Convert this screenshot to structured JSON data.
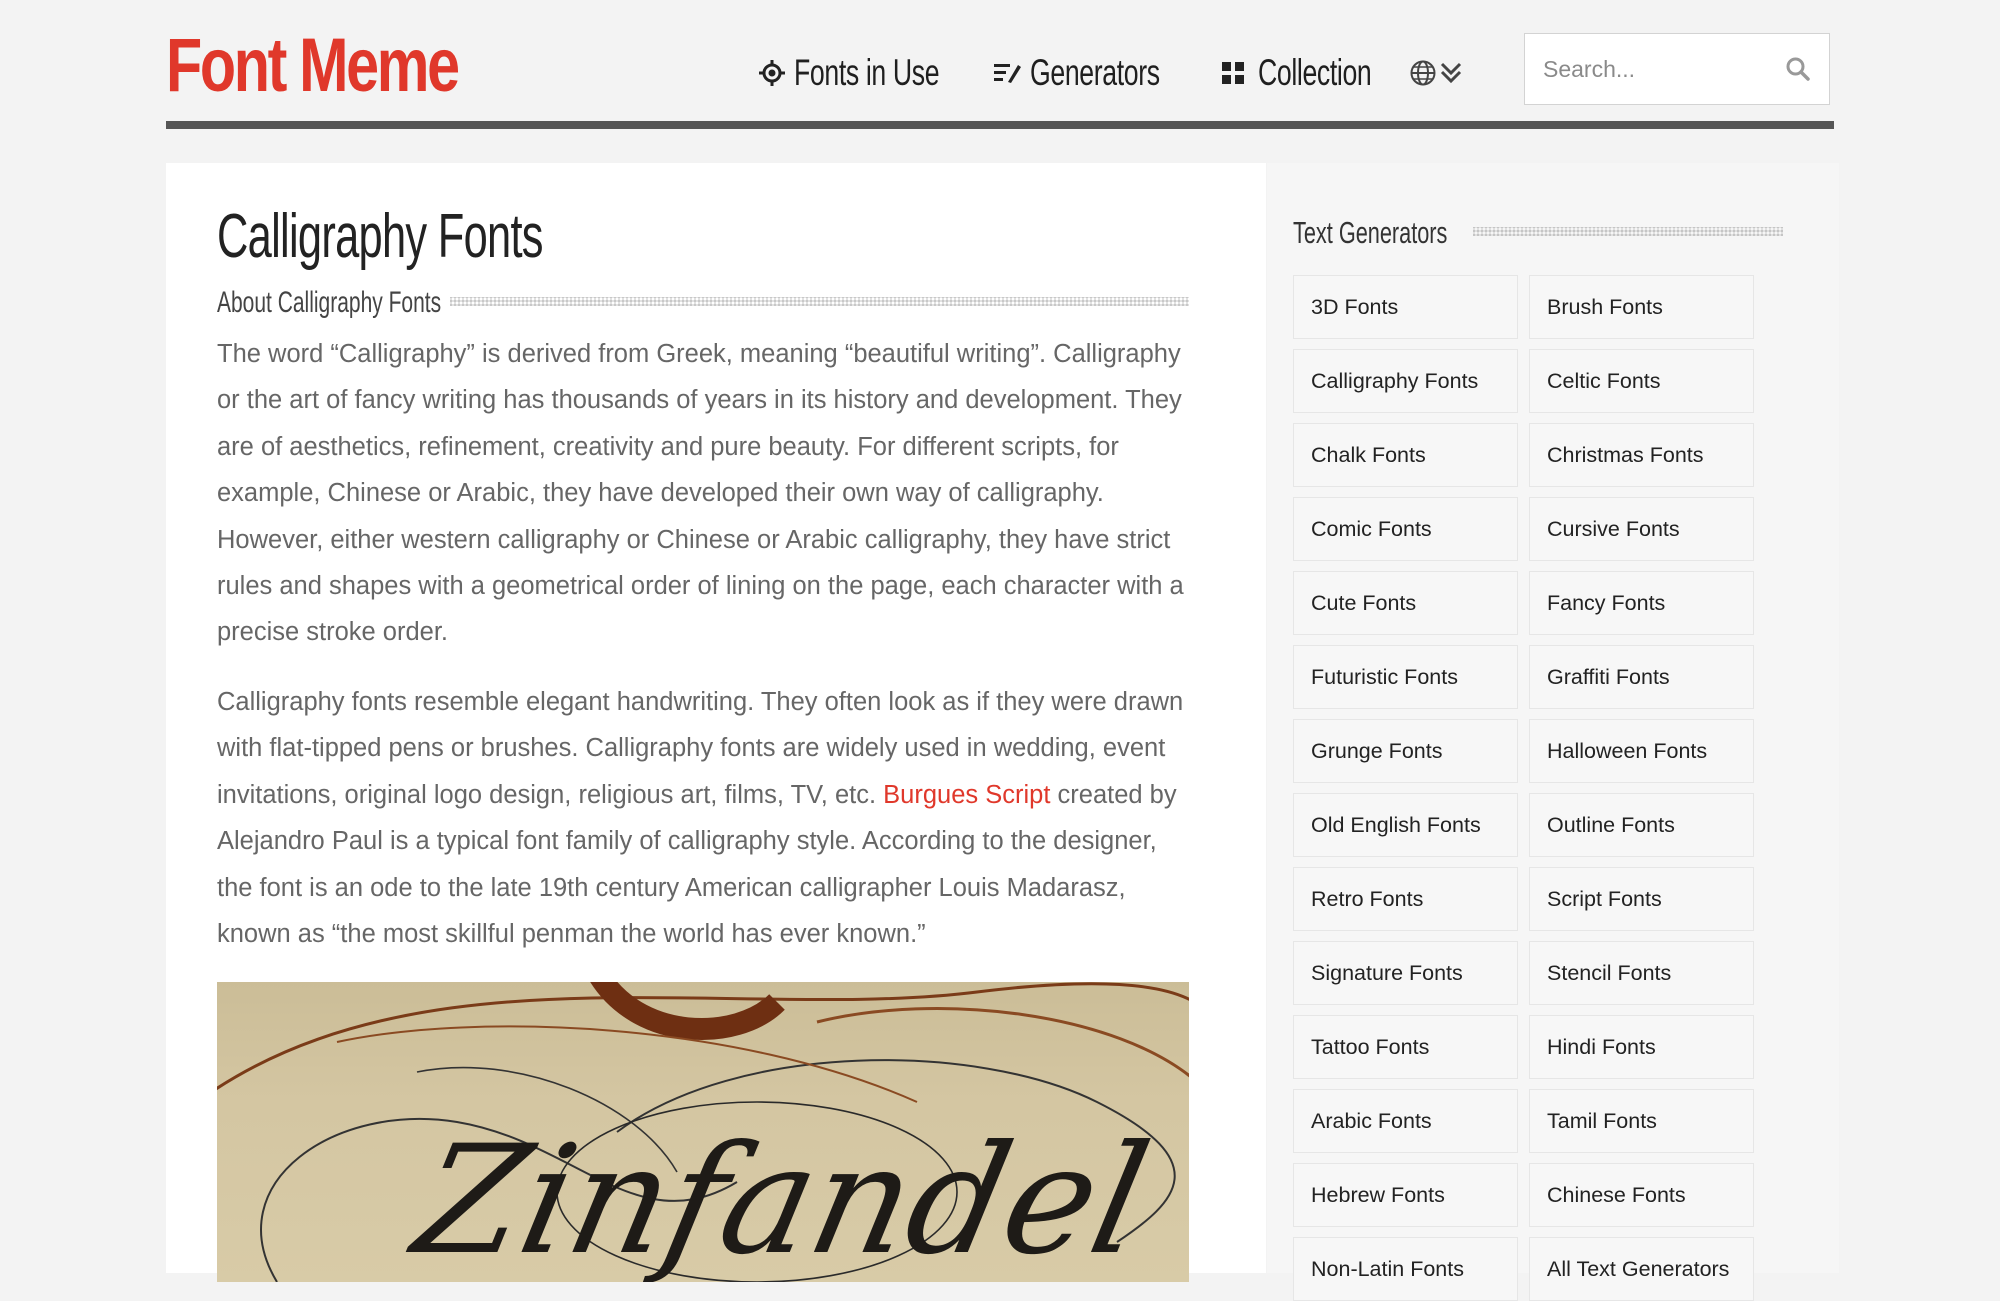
{
  "header": {
    "logo": "Font Meme",
    "nav": [
      {
        "label": "Fonts in Use",
        "icon": "crosshair-icon"
      },
      {
        "label": "Generators",
        "icon": "generators-list-icon"
      },
      {
        "label": "Collection",
        "icon": "grid-icon"
      }
    ],
    "language_icon": "globe-icon",
    "dropdown_icon": "double-chevron-down-icon",
    "search": {
      "placeholder": "Search...",
      "value": ""
    }
  },
  "main": {
    "title": "Calligraphy Fonts",
    "section_title": "About Calligraphy Fonts",
    "paragraph1": "The word “Calligraphy” is derived from Greek, meaning “beautiful writing”. Calligraphy or the art of fancy writing has thousands of years in its history and development. They are of aesthetics, refinement, creativity and pure beauty. For different scripts, for example, Chinese or Arabic, they have developed their own way of calligraphy. However, either western calligraphy or Chinese or Arabic calligraphy, they have strict rules and shapes with a geometrical order of lining on the page, each character with a precise stroke order.",
    "paragraph2_before": "Calligraphy fonts resemble elegant handwriting. They often look as if they were drawn with flat-tipped pens or brushes. Calligraphy fonts are widely used in wedding, event invitations, original logo design, religious art, films, TV, etc.",
    "paragraph2_link": "Burgues Script",
    "paragraph2_after": "created by Alejandro Paul is a typical font family of calligraphy style. According to the designer, the font is an ode to the late 19th century American calligrapher Louis Madarasz, known as “the most skillful penman the world has ever known.”",
    "hero_text": "Zinfandel"
  },
  "sidebar": {
    "title": "Text Generators",
    "items": [
      "3D Fonts",
      "Brush Fonts",
      "Calligraphy Fonts",
      "Celtic Fonts",
      "Chalk Fonts",
      "Christmas Fonts",
      "Comic Fonts",
      "Cursive Fonts",
      "Cute Fonts",
      "Fancy Fonts",
      "Futuristic Fonts",
      "Graffiti Fonts",
      "Grunge Fonts",
      "Halloween Fonts",
      "Old English Fonts",
      "Outline Fonts",
      "Retro Fonts",
      "Script Fonts",
      "Signature Fonts",
      "Stencil Fonts",
      "Tattoo Fonts",
      "Hindi Fonts",
      "Arabic Fonts",
      "Tamil Fonts",
      "Hebrew Fonts",
      "Chinese Fonts",
      "Non-Latin Fonts",
      "All Text Generators"
    ]
  },
  "colors": {
    "brand": "#e0382b",
    "text": "#666666",
    "heading": "#222222"
  }
}
